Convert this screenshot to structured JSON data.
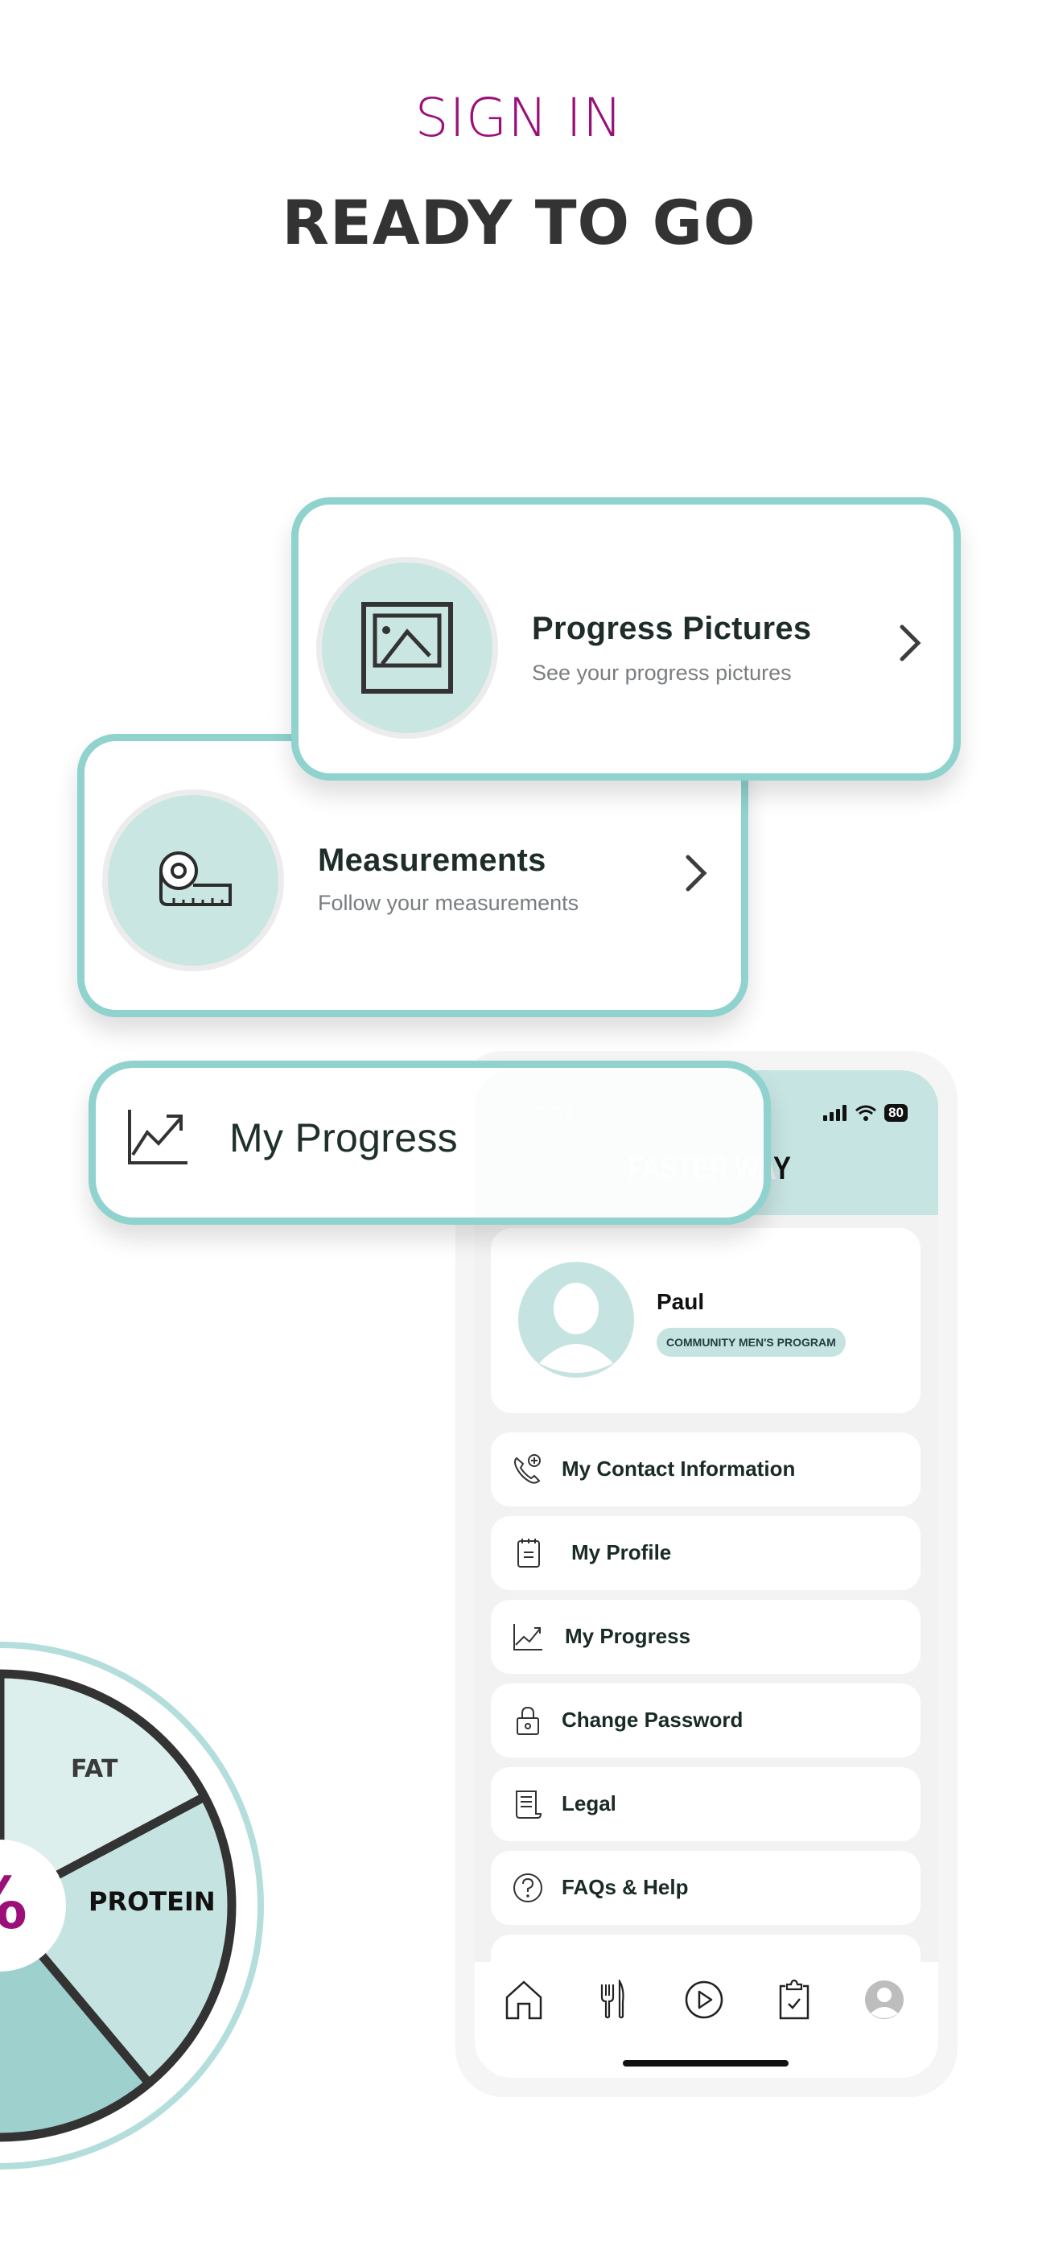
{
  "header": {
    "sign_in": "SIGN IN",
    "title": "READY TO GO"
  },
  "colors": {
    "accent_magenta": "#9b0f78",
    "teal_border": "#90d2cd",
    "teal_light": "#c6e4e2",
    "text_dark": "#1e2d2a"
  },
  "feature_cards": {
    "pictures": {
      "icon": "image-frame-icon",
      "title": "Progress Pictures",
      "subtitle": "See your progress pictures"
    },
    "measurements": {
      "icon": "tape-measure-icon",
      "title": "Measurements",
      "subtitle": "Follow your measurements"
    },
    "progress": {
      "icon": "trend-chart-icon",
      "title": "My Progress"
    }
  },
  "phone": {
    "status_bar": {
      "time": "2:27",
      "battery": "80"
    },
    "brand": {
      "faded": "FASTER WA",
      "dark": "Y"
    },
    "profile": {
      "name": "Paul",
      "program": "COMMUNITY MEN'S PROGRAM"
    },
    "menu": [
      {
        "label": "My Contact Information",
        "icon": "phone-plus-icon"
      },
      {
        "label": "My Profile",
        "icon": "notepad-icon"
      },
      {
        "label": "My Progress",
        "icon": "trend-chart-icon"
      },
      {
        "label": "Change Password",
        "icon": "lock-icon"
      },
      {
        "label": "Legal",
        "icon": "document-scroll-icon"
      },
      {
        "label": "FAQs & Help",
        "icon": "help-circle-icon"
      }
    ],
    "tabs": [
      {
        "name": "home",
        "icon": "home-icon"
      },
      {
        "name": "nutrition",
        "icon": "fork-knife-icon"
      },
      {
        "name": "workouts",
        "icon": "play-circle-icon"
      },
      {
        "name": "checklist",
        "icon": "clipboard-check-icon"
      },
      {
        "name": "account",
        "icon": "avatar-icon"
      }
    ]
  },
  "macro_graphic": {
    "center_text": "%",
    "segments": [
      {
        "label": "FAT"
      },
      {
        "label": "PROTEIN"
      },
      {
        "label": ""
      }
    ]
  }
}
